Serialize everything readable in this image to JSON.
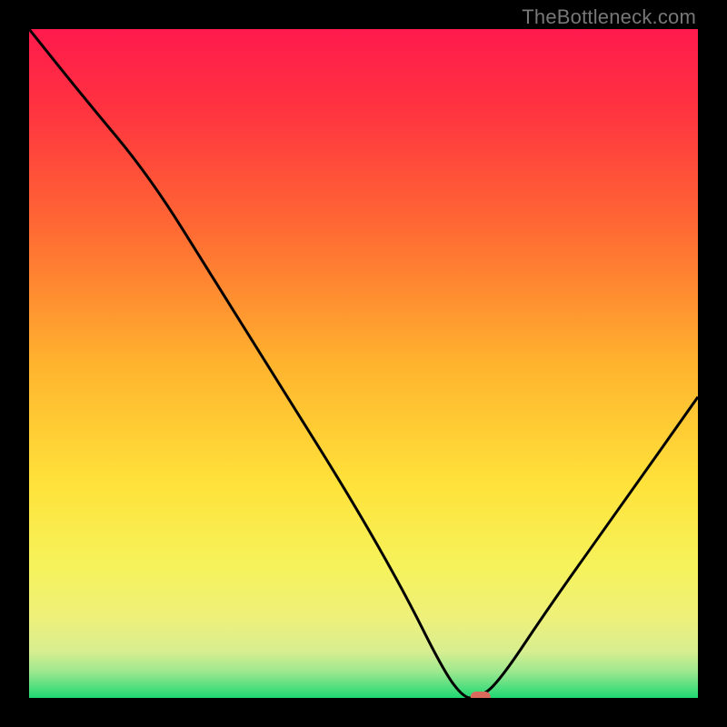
{
  "watermark": "TheBottleneck.com",
  "chart_data": {
    "type": "line",
    "title": "",
    "xlabel": "",
    "ylabel": "",
    "xlim": [
      0,
      100
    ],
    "ylim": [
      0,
      100
    ],
    "x": [
      0,
      8,
      18,
      28,
      38,
      48,
      56,
      62,
      65,
      67,
      70,
      78,
      88,
      100
    ],
    "values": [
      100,
      90,
      78,
      62,
      46,
      30,
      16,
      4,
      0,
      0,
      2,
      14,
      28,
      45
    ],
    "gradient_stops": [
      {
        "pct": 0,
        "color": "#ff1a4d"
      },
      {
        "pct": 12,
        "color": "#ff3340"
      },
      {
        "pct": 30,
        "color": "#ff6a33"
      },
      {
        "pct": 50,
        "color": "#ffb32e"
      },
      {
        "pct": 68,
        "color": "#ffe23a"
      },
      {
        "pct": 80,
        "color": "#f6f25a"
      },
      {
        "pct": 88,
        "color": "#eef07a"
      },
      {
        "pct": 93,
        "color": "#d8ee90"
      },
      {
        "pct": 96,
        "color": "#9fe88f"
      },
      {
        "pct": 100,
        "color": "#1fd873"
      }
    ],
    "marker": {
      "x": 67.5,
      "y": 0,
      "color": "#d96a5c"
    }
  }
}
